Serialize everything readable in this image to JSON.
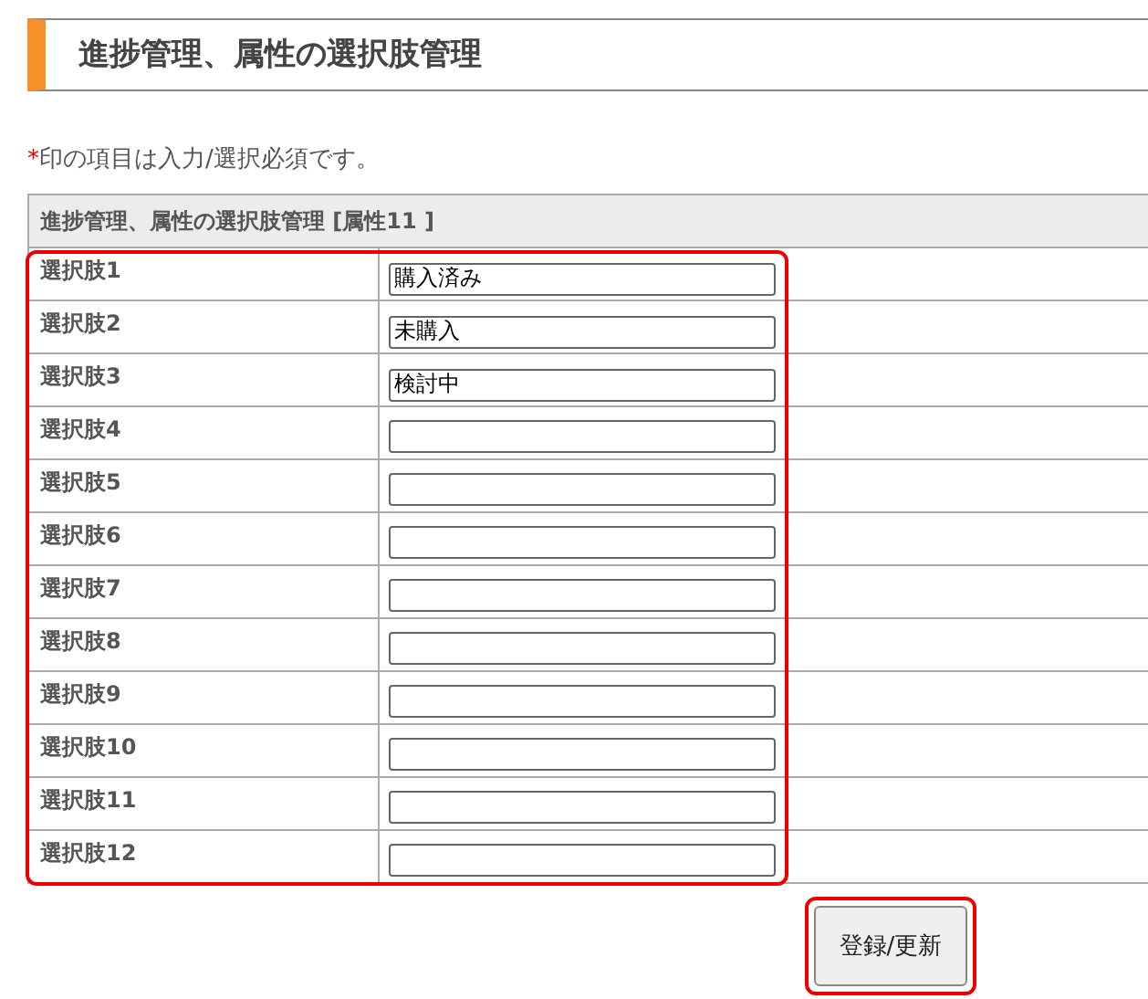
{
  "heading": "進捗管理、属性の選択肢管理",
  "required_note": {
    "mark": "*",
    "text": "印の項目は入力/選択必須です。"
  },
  "table": {
    "title": "進捗管理、属性の選択肢管理 [属性11 ]",
    "rows": [
      {
        "label": "選択肢1",
        "value": "購入済み"
      },
      {
        "label": "選択肢2",
        "value": "未購入"
      },
      {
        "label": "選択肢3",
        "value": "検討中"
      },
      {
        "label": "選択肢4",
        "value": ""
      },
      {
        "label": "選択肢5",
        "value": ""
      },
      {
        "label": "選択肢6",
        "value": ""
      },
      {
        "label": "選択肢7",
        "value": ""
      },
      {
        "label": "選択肢8",
        "value": ""
      },
      {
        "label": "選択肢9",
        "value": ""
      },
      {
        "label": "選択肢10",
        "value": ""
      },
      {
        "label": "選択肢11",
        "value": ""
      },
      {
        "label": "選択肢12",
        "value": ""
      }
    ]
  },
  "submit_button": "登録/更新"
}
